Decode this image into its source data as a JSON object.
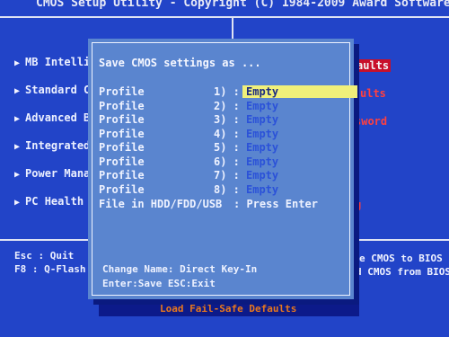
{
  "header": {
    "title": "CMOS Setup Utility - Copyright (C) 1984-2009 Award Software"
  },
  "left_menu": [
    {
      "label": "MB Intellig"
    },
    {
      "label": "Standard CM"
    },
    {
      "label": "Advanced BI"
    },
    {
      "label": "Integrated "
    },
    {
      "label": "Power Manag"
    },
    {
      "label": "PC Health S"
    }
  ],
  "right_menu": [
    {
      "label": "aults"
    },
    {
      "label": "ults"
    },
    {
      "label": "sword"
    },
    {
      "label": "g"
    }
  ],
  "footer": {
    "esc_line": "Esc : Quit",
    "f8_line": "F8  : Q-Flash",
    "right_line1": "e CMOS to BIOS",
    "right_line2": "d CMOS from BIOS",
    "bottom_bar": "Load Fail-Safe Defaults"
  },
  "dialog": {
    "title": "Save CMOS settings as ...",
    "profiles": [
      {
        "label": "Profile",
        "num": "1) :",
        "value": "Empty"
      },
      {
        "label": "Profile",
        "num": "2) :",
        "value": "Empty"
      },
      {
        "label": "Profile",
        "num": "3) :",
        "value": "Empty"
      },
      {
        "label": "Profile",
        "num": "4) :",
        "value": "Empty"
      },
      {
        "label": "Profile",
        "num": "5) :",
        "value": "Empty"
      },
      {
        "label": "Profile",
        "num": "6) :",
        "value": "Empty"
      },
      {
        "label": "Profile",
        "num": "7) :",
        "value": "Empty"
      },
      {
        "label": "Profile",
        "num": "8) :",
        "value": "Empty"
      }
    ],
    "file_label": "File in HDD/FDD/USB",
    "file_action": ": Press Enter",
    "help_line1": "Change Name: Direct Key-In",
    "help_line2": "Enter:Save  ESC:Exit"
  },
  "colors": {
    "screen_bg": "#2244c8",
    "dialog_bg": "#5a85cf",
    "selection": "#f0f07a",
    "accent_red": "#c8102a",
    "orange": "#e8781c"
  }
}
